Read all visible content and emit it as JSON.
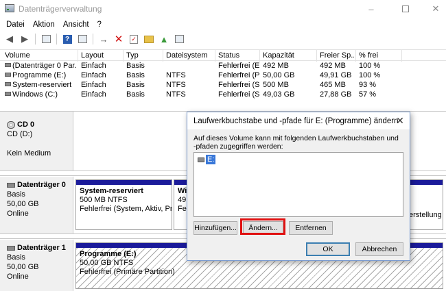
{
  "window": {
    "title": "Datenträgerverwaltung",
    "min": "–",
    "close": "✕"
  },
  "menu": [
    "Datei",
    "Aktion",
    "Ansicht",
    "?"
  ],
  "toolbar": {
    "icons": [
      "back-arrow",
      "forward-arrow",
      "properties",
      "help",
      "properties-2",
      "connect",
      "delete",
      "check",
      "folder-up",
      "settings"
    ]
  },
  "volumes": {
    "columns": [
      "Volume",
      "Layout",
      "Typ",
      "Dateisystem",
      "Status",
      "Kapazität",
      "Freier Sp...",
      "% frei"
    ],
    "rows": [
      [
        "(Datenträger 0 Par...",
        "Einfach",
        "Basis",
        "",
        "Fehlerfrei (E...",
        "492 MB",
        "492 MB",
        "100 %"
      ],
      [
        "Programme (E:)",
        "Einfach",
        "Basis",
        "NTFS",
        "Fehlerfrei (P...",
        "50,00 GB",
        "49,91 GB",
        "100 %"
      ],
      [
        "System-reserviert",
        "Einfach",
        "Basis",
        "NTFS",
        "Fehlerfrei (S...",
        "500 MB",
        "465 MB",
        "93 %"
      ],
      [
        "Windows (C:)",
        "Einfach",
        "Basis",
        "NTFS",
        "Fehlerfrei (S...",
        "49,03 GB",
        "27,88 GB",
        "57 %"
      ]
    ]
  },
  "disks": {
    "cd": {
      "name": "CD 0",
      "drive": "CD (D:)",
      "status": "Kein Medium"
    },
    "disk0": {
      "name": "Datenträger 0",
      "type": "Basis",
      "size": "50,00 GB",
      "state": "Online",
      "partitions": [
        {
          "title": "System-reserviert",
          "size": "500 MB NTFS",
          "status": "Fehlerfrei (System, Aktiv, Pri"
        },
        {
          "title": "Wi",
          "size": "49",
          "status": "Fe"
        }
      ],
      "overflow_text": "erstellung"
    },
    "disk1": {
      "name": "Datenträger 1",
      "type": "Basis",
      "size": "50,00 GB",
      "state": "Online",
      "partitions": [
        {
          "title": "Programme  (E:)",
          "size": "50,00 GB NTFS",
          "status": "Fehlerfrei (Primäre Partition)"
        }
      ]
    }
  },
  "dialog": {
    "title": "Laufwerkbuchstabe und -pfade für E: (Programme) ändern",
    "description": "Auf dieses Volume kann mit folgenden Laufwerkbuchstaben und -pfaden zugegriffen werden:",
    "list_items": [
      "E:"
    ],
    "buttons": {
      "add": "Hinzufügen...",
      "change": "Ändern...",
      "remove": "Entfernen",
      "ok": "OK",
      "cancel": "Abbrechen"
    },
    "close": "✕"
  },
  "colors": {
    "partition_bar": "#1b1b9a",
    "highlight": "#e01010",
    "selection": "#3877d8"
  }
}
